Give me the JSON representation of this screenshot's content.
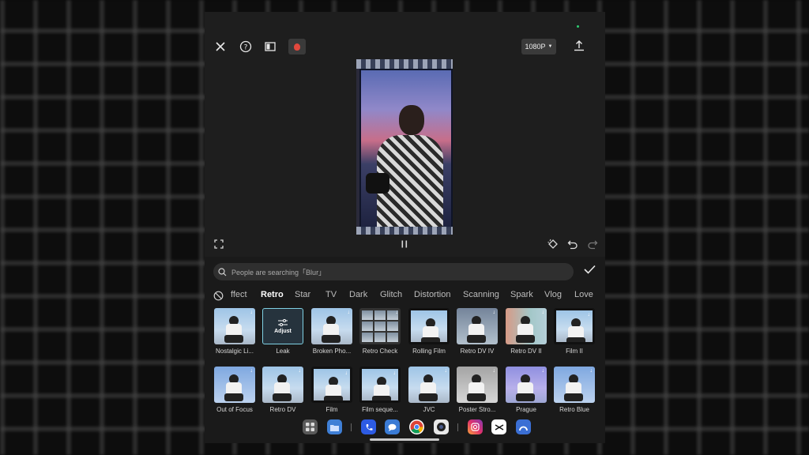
{
  "toolbar": {
    "close_icon": "close-icon",
    "help_icon": "help-icon",
    "layout_icon": "layout-icon",
    "record_icon": "record-icon",
    "resolution": "1080P",
    "export_icon": "export-icon"
  },
  "preview_controls": {
    "fullscreen_icon": "fullscreen-icon",
    "play_pause_icon": "pause-icon",
    "keyframe_icon": "keyframe-icon",
    "undo_icon": "undo-icon",
    "redo_icon": "redo-icon"
  },
  "search": {
    "placeholder": "People are searching「Blur」"
  },
  "categories": [
    "ffect",
    "Retro",
    "Star",
    "TV",
    "Dark",
    "Glitch",
    "Distortion",
    "Scanning",
    "Spark",
    "Vlog",
    "Love"
  ],
  "active_category": "Retro",
  "effects_row1": [
    "Nostalgic Li...",
    "Leak",
    "Broken Pho...",
    "Retro Check",
    "Rolling Film",
    "Retro DV IV",
    "Retro DV II",
    "Film II"
  ],
  "effects_row2": [
    "Out of Focus",
    "Retro DV",
    "Film",
    "Film seque...",
    "JVC",
    "Poster Stro...",
    "Prague",
    "Retro Blue"
  ],
  "adjust_label": "Adjust",
  "dock_apps": [
    "apps-icon",
    "files-icon",
    "phone-icon",
    "messages-icon",
    "chrome-icon",
    "camera-icon",
    "instagram-icon",
    "capcut-icon",
    "arc-icon"
  ]
}
